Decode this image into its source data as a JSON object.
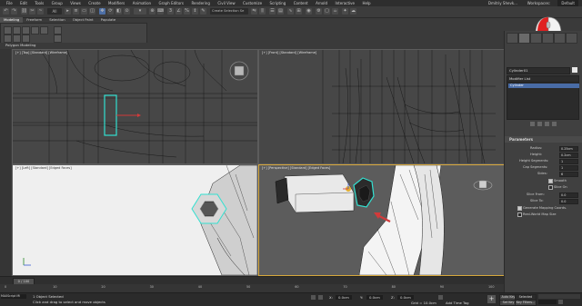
{
  "menu": {
    "items": [
      "File",
      "Edit",
      "Tools",
      "Group",
      "Views",
      "Create",
      "Modifiers",
      "Animation",
      "Graph Editors",
      "Rendering",
      "Civil View",
      "Customize",
      "Scripting",
      "Content",
      "Arnold",
      "Interactive",
      "Help"
    ],
    "user": "Dmitriy Shevk...",
    "workspace_label": "Workspaces:",
    "workspace_value": "Default"
  },
  "toolbar": {
    "filter_value": "All",
    "selection_set_placeholder": "Create Selection Se"
  },
  "ribbon": {
    "tabs": [
      "Modeling",
      "Freeform",
      "Selection",
      "Object Paint",
      "Populate"
    ],
    "panel_label": "Polygon Modeling"
  },
  "viewports": {
    "top_label": "[+] [Top] [Standard] [Wireframe]",
    "front_label": "[+] [Front] [Standard] [Wireframe]",
    "left_label": "[+] [Left] [Standard] [Edged Faces]",
    "persp_label": "[+] [Perspective] [Standard] [Edged Faces]"
  },
  "command_panel": {
    "object_name": "Cylinder01",
    "modifier_list": "Modifier List",
    "stack_item": "Cylinder",
    "rollout_title": "Parameters",
    "params": [
      {
        "label": "Radius:",
        "value": "0.25cm"
      },
      {
        "label": "Height:",
        "value": "0.2cm"
      },
      {
        "label": "Height Segments:",
        "value": "1"
      },
      {
        "label": "Cap Segments:",
        "value": "1"
      },
      {
        "label": "Sides:",
        "value": "6"
      }
    ],
    "smooth_label": "Smooth",
    "slice_on_label": "Slice On",
    "slice_from_label": "Slice From:",
    "slice_to_label": "Slice To:",
    "slice_from_value": "0.0",
    "slice_to_value": "0.0",
    "gen_mapping_label": "Generate Mapping Coords.",
    "real_world_label": "Real-World Map Size"
  },
  "timeline": {
    "frame_display": "0 / 100",
    "ticks": [
      "0",
      "10",
      "20",
      "30",
      "40",
      "50",
      "60",
      "70",
      "80",
      "90",
      "100"
    ]
  },
  "status": {
    "maxscript": "MAXScript Mi",
    "selected": "1 Object Selected",
    "hint": "Click and drag to select and move objects",
    "x_label": "X:",
    "x_val": "0.0cm",
    "y_label": "Y:",
    "y_val": "0.0cm",
    "z_label": "Z:",
    "z_val": "0.0cm",
    "grid": "Grid = 10.0cm",
    "add_time_tag": "Add Time Tag",
    "auto_key": "Auto Key",
    "selected_btn": "Selected",
    "set_key": "Set Key",
    "key_filters": "Key Filters..."
  },
  "colors": {
    "selection_cyan": "#33e0d0",
    "active_border": "#d7a83c",
    "annotation_red": "#d23a3a"
  }
}
